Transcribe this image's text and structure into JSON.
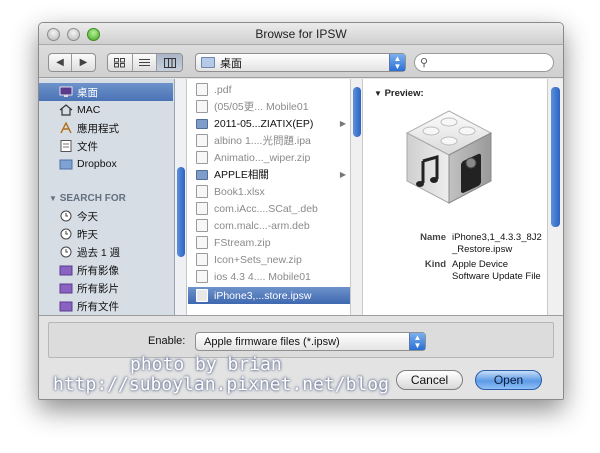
{
  "window": {
    "title": "Browse for IPSW"
  },
  "toolbar": {
    "path_label": "桌面",
    "search_placeholder": "",
    "nav_back": "◀",
    "nav_forward": "▶"
  },
  "sidebar": {
    "items_top": [
      {
        "label": "桌面",
        "icon": "desktop-icon",
        "selected": true
      },
      {
        "label": "MAC",
        "icon": "home-icon"
      },
      {
        "label": "應用程式",
        "icon": "applications-icon"
      },
      {
        "label": "文件",
        "icon": "documents-icon"
      },
      {
        "label": "Dropbox",
        "icon": "dropbox-folder-icon"
      }
    ],
    "search_section": "SEARCH FOR",
    "items_search": [
      {
        "label": "今天",
        "icon": "clock-icon"
      },
      {
        "label": "昨天",
        "icon": "clock-icon"
      },
      {
        "label": "過去 1 週",
        "icon": "clock-icon"
      },
      {
        "label": "所有影像",
        "icon": "smart-folder-icon"
      },
      {
        "label": "所有影片",
        "icon": "smart-folder-icon"
      },
      {
        "label": "所有文件",
        "icon": "smart-folder-icon"
      }
    ]
  },
  "files": [
    {
      "name": ".pdf",
      "type": "file",
      "dim": true
    },
    {
      "name": "(05/05更... Mobile01",
      "type": "file",
      "dim": true
    },
    {
      "name": "2011-05...ZIATIX(EP)",
      "type": "folder",
      "arrow": "▶"
    },
    {
      "name": "albino 1....光問題.ipa",
      "type": "file",
      "dim": true
    },
    {
      "name": "Animatio..._wiper.zip",
      "type": "file",
      "dim": true
    },
    {
      "name": "APPLE相關",
      "type": "folder",
      "arrow": "▶"
    },
    {
      "name": "Book1.xlsx",
      "type": "file",
      "dim": true
    },
    {
      "name": "com.iAcc....SCat_.deb",
      "type": "file",
      "dim": true
    },
    {
      "name": "com.malc...-arm.deb",
      "type": "file",
      "dim": true
    },
    {
      "name": "FStream.zip",
      "type": "file",
      "dim": true
    },
    {
      "name": "Icon+Sets_new.zip",
      "type": "file",
      "dim": true
    },
    {
      "name": "ios 4.3 4.... Mobile01",
      "type": "file",
      "dim": true
    },
    {
      "name": "iPhone3,...store.ipsw",
      "type": "ipsw",
      "selected": true
    }
  ],
  "preview": {
    "header": "Preview:",
    "name_label": "Name",
    "name_value": "iPhone3,1_4.3.3_8J2_Restore.ipsw",
    "kind_label": "Kind",
    "kind_value": "Apple Device Software Update File"
  },
  "bottom": {
    "enable_label": "Enable:",
    "enable_value": "Apple firmware files (*.ipsw)",
    "cancel_label": "Cancel",
    "open_label": "Open"
  },
  "watermark": {
    "line1": "photo by brian",
    "line2": "http://suboylan.pixnet.net/blog"
  }
}
